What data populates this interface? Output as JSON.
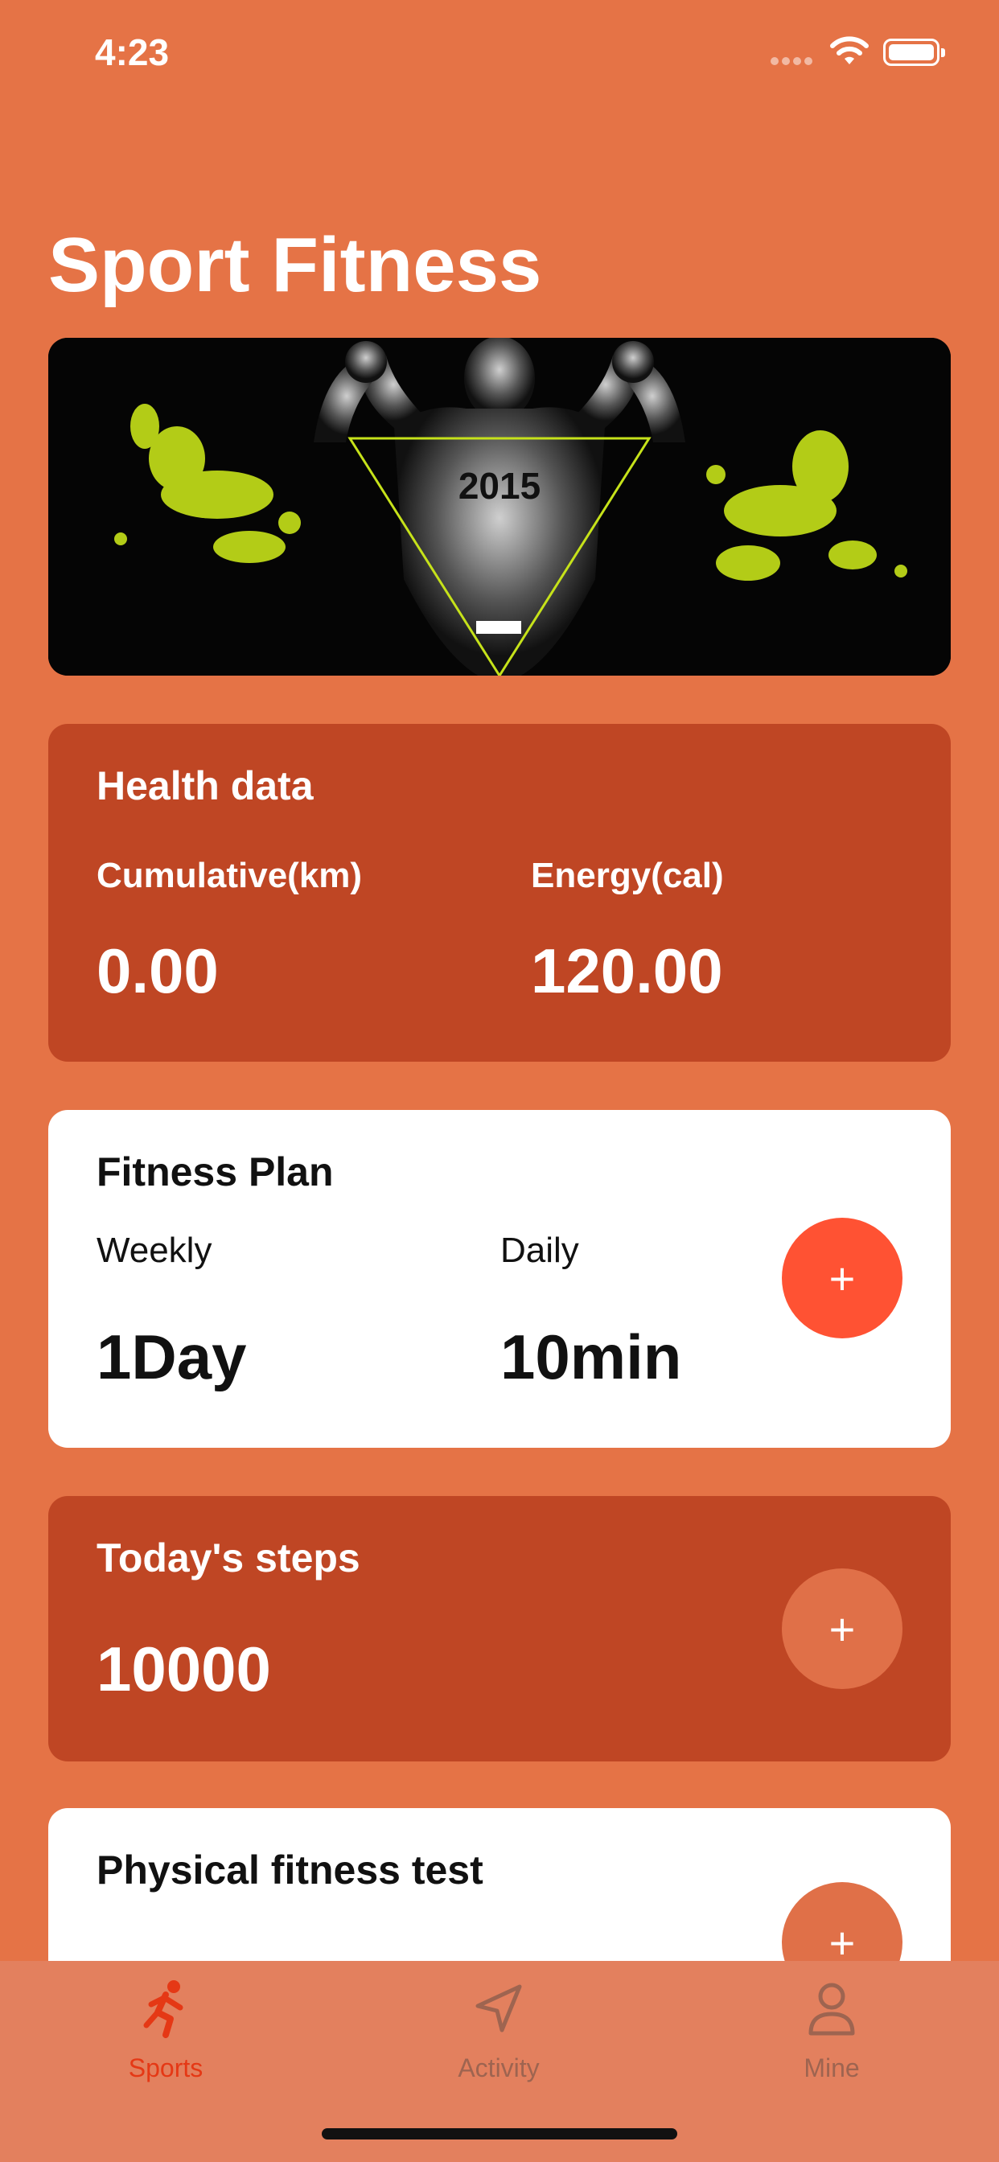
{
  "status_bar": {
    "time": "4:23"
  },
  "page": {
    "title": "Sport Fitness"
  },
  "banner": {
    "year_text": "2015"
  },
  "health_data": {
    "title": "Health data",
    "cumulative_label": "Cumulative(km)",
    "cumulative_value": "0.00",
    "energy_label": "Energy(cal)",
    "energy_value": "120.00"
  },
  "fitness_plan": {
    "title": "Fitness Plan",
    "weekly_label": "Weekly",
    "weekly_value": "1Day",
    "daily_label": "Daily",
    "daily_value": "10min",
    "add_label": "+"
  },
  "steps": {
    "title": "Today's steps",
    "value": "10000",
    "add_label": "+"
  },
  "fitness_test": {
    "title": "Physical fitness test",
    "add_label": "+"
  },
  "tab_bar": {
    "tabs": [
      {
        "label": "Sports",
        "icon": "running-person-icon",
        "active": true
      },
      {
        "label": "Activity",
        "icon": "navigation-arrow-icon",
        "active": false
      },
      {
        "label": "Mine",
        "icon": "person-icon",
        "active": false
      }
    ]
  },
  "colors": {
    "background": "#E57346",
    "card_dark": "#BF4624",
    "accent": "#FF5233",
    "tab_active": "#E53815"
  }
}
